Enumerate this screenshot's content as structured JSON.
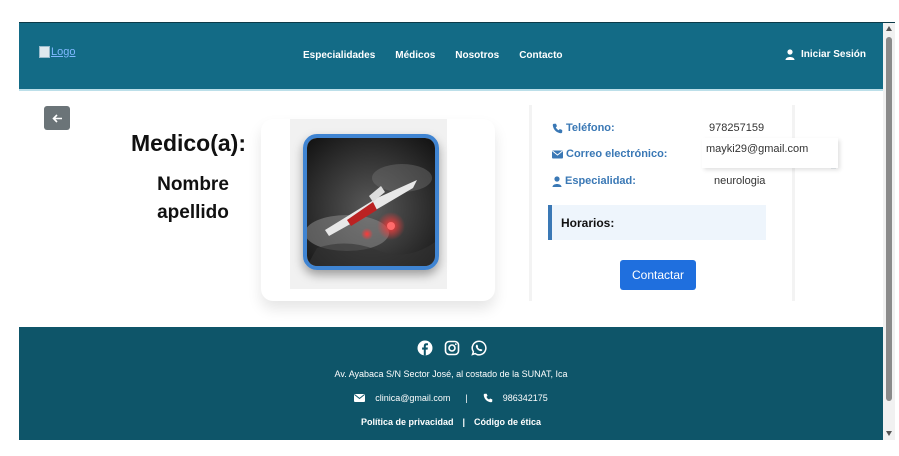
{
  "header": {
    "logo_alt": "Logo",
    "nav": [
      "Especialidades",
      "Médicos",
      "Nosotros",
      "Contacto"
    ],
    "login_label": "Iniciar Sesión"
  },
  "profile": {
    "title": "Medico(a):",
    "name": "Nombre apellido"
  },
  "info": {
    "phone_label": "Teléfono:",
    "phone_value": "978257159",
    "email_label": "Correo electrónico:",
    "email_value": "mayki29@gmail.com",
    "specialty_label": "Especialidad:",
    "specialty_value": "neurologia",
    "schedule_label": "Horarios:",
    "contact_button": "Contactar"
  },
  "footer": {
    "address": "Av. Ayabaca S/N Sector José, al costado de la SUNAT, Ica",
    "email": "clinica@gmail.com",
    "separator": "|",
    "phone": "986342175",
    "privacy": "Política de privacidad",
    "ethics": "Código de ética"
  },
  "colors": {
    "header_bg": "#136b86",
    "footer_bg": "#0e5569",
    "accent": "#3a78b5",
    "button": "#1f6fde"
  },
  "icons": {
    "social": [
      "facebook-icon",
      "instagram-icon",
      "whatsapp-icon"
    ]
  }
}
